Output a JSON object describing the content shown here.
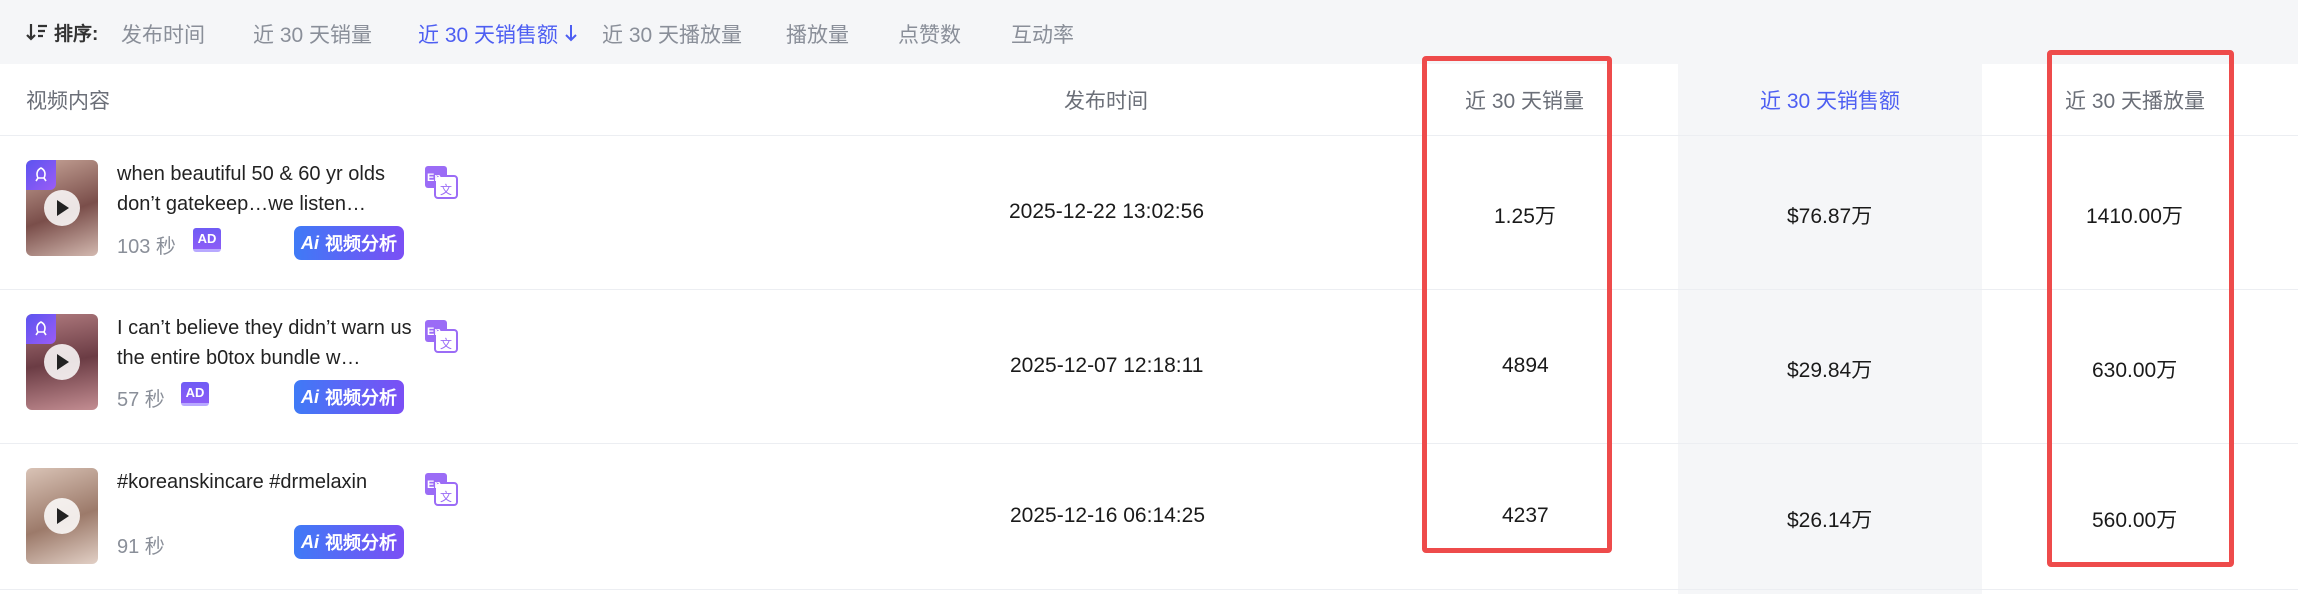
{
  "sort_bar": {
    "label": "排序:",
    "options": [
      "发布时间",
      "近 30 天销量",
      "近 30 天销售额",
      "近 30 天播放量",
      "播放量",
      "点赞数",
      "互动率"
    ],
    "active_index": 2,
    "active_color": "#4d5ef2"
  },
  "table": {
    "headers": [
      "视频内容",
      "发布时间",
      "近 30 天销量",
      "近 30 天销售额",
      "近 30 天播放量"
    ],
    "rows": [
      {
        "title": "when beautiful 50 & 60 yr olds don’t gatekeep…we listen…",
        "duration": "103 秒",
        "has_ad": true,
        "analyze_label": "视频分析",
        "publish_time": "2025-12-22 13:02:56",
        "sales_30d": "1.25万",
        "revenue_30d": "$76.87万",
        "plays_30d": "1410.00万"
      },
      {
        "title": "I can’t believe they didn’t warn us the entire b0tox bundle w…",
        "duration": "57 秒",
        "has_ad": true,
        "analyze_label": "视频分析",
        "publish_time": "2025-12-07 12:18:11",
        "sales_30d": "4894",
        "revenue_30d": "$29.84万",
        "plays_30d": "630.00万"
      },
      {
        "title": "#koreanskincare #drmelaxin",
        "duration": "91 秒",
        "has_ad": false,
        "analyze_label": "视频分析",
        "publish_time": "2025-12-16 06:14:25",
        "sales_30d": "4237",
        "revenue_30d": "$26.14万",
        "plays_30d": "560.00万"
      }
    ]
  },
  "badges": {
    "ad_label": "AD",
    "translate_label": "En",
    "ai_label": "Ai"
  },
  "highlight_color": "#ee4b4b"
}
